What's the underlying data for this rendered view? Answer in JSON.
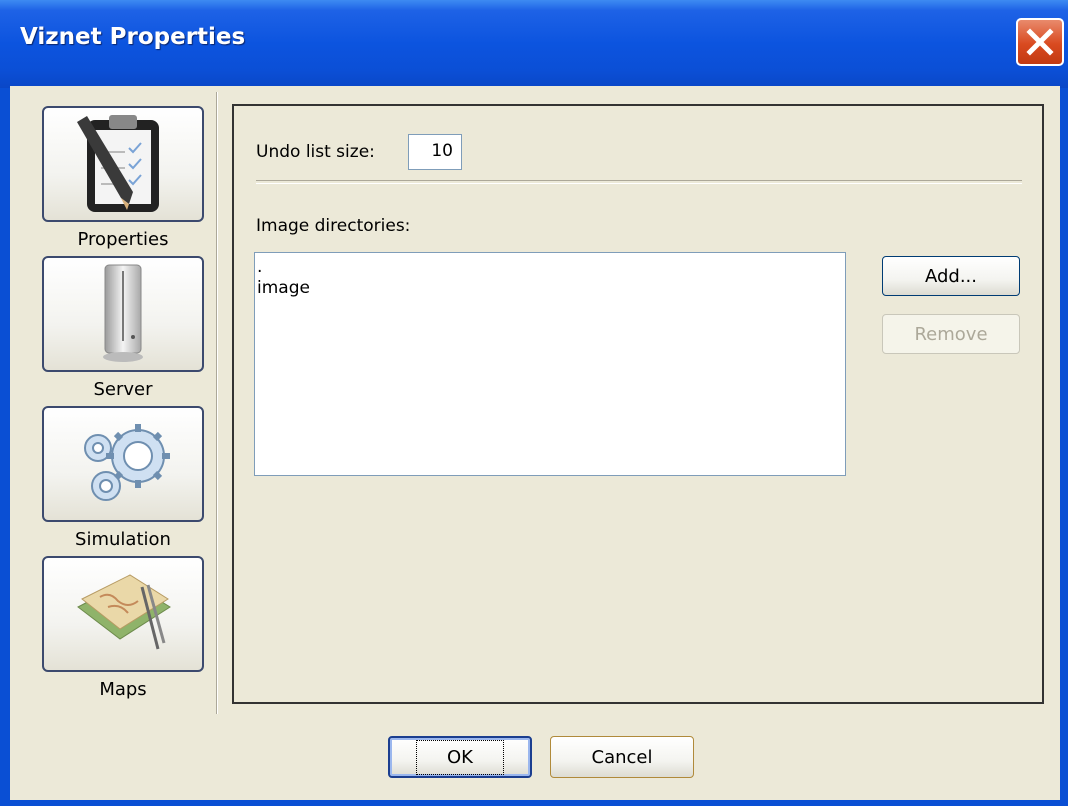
{
  "window": {
    "title": "Viznet Properties",
    "close_icon": "close-icon"
  },
  "sidebar": {
    "items": [
      {
        "label": "Properties",
        "icon": "clipboard-pencil-icon"
      },
      {
        "label": "Server",
        "icon": "server-tower-icon"
      },
      {
        "label": "Simulation",
        "icon": "gears-icon"
      },
      {
        "label": "Maps",
        "icon": "map-icon"
      }
    ]
  },
  "settings": {
    "undo_label": "Undo list size:",
    "undo_value": "10",
    "image_dirs_label": "Image directories:",
    "image_dirs": [
      ".",
      "image"
    ],
    "add_button": "Add...",
    "remove_button": "Remove"
  },
  "footer": {
    "ok_label": "OK",
    "cancel_label": "Cancel"
  },
  "colors": {
    "titlebar": "#0c54df",
    "client": "#ece9d8",
    "close": "#d94a20"
  }
}
